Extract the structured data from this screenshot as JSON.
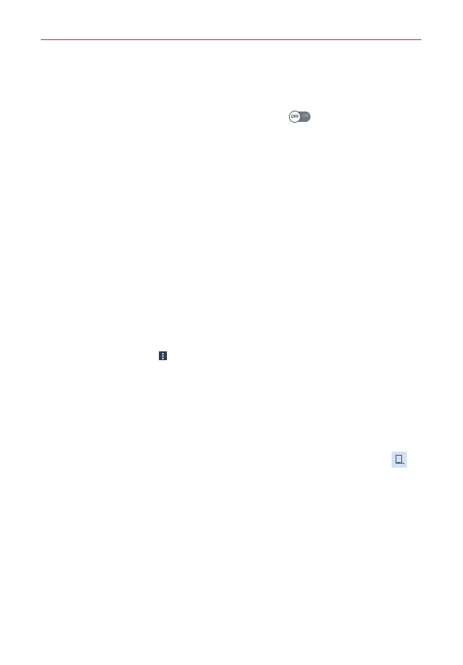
{
  "header": {
    "rule_color": "#d23a2e"
  },
  "toggle": {
    "state_label": "OFF",
    "on_label": "ON",
    "icon": "toggle-switch-off-icon"
  },
  "menu_icon": {
    "icon": "overflow-menu-icon"
  },
  "device_icon": {
    "icon": "mobile-device-icon"
  }
}
